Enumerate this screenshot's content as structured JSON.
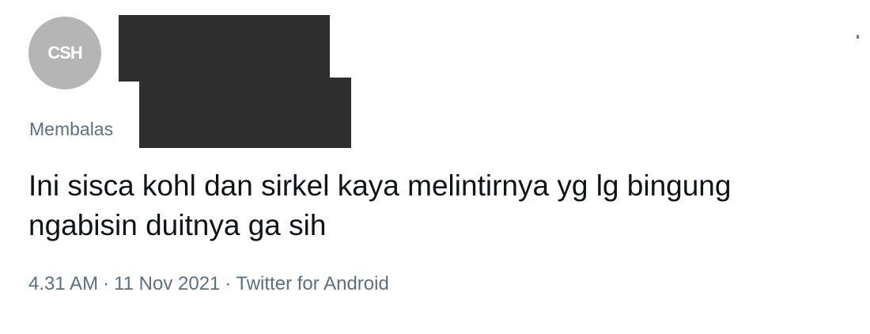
{
  "avatar": {
    "initials": "CSH"
  },
  "reply": {
    "prefix": "Membalas"
  },
  "tweet": {
    "text_line1": "Ini sisca kohl dan sirkel kaya melintirnya yg lg bingung",
    "text_line2": "ngabisin duitnya ga sih"
  },
  "meta": {
    "time": "4.31 AM",
    "date": "11 Nov 2021",
    "source": "Twitter for Android",
    "separator": "·"
  },
  "colors": {
    "text_primary": "#0f1419",
    "text_secondary": "#5b7083",
    "avatar_bg": "#b5b5b5",
    "redaction": "#2e2e2e"
  }
}
